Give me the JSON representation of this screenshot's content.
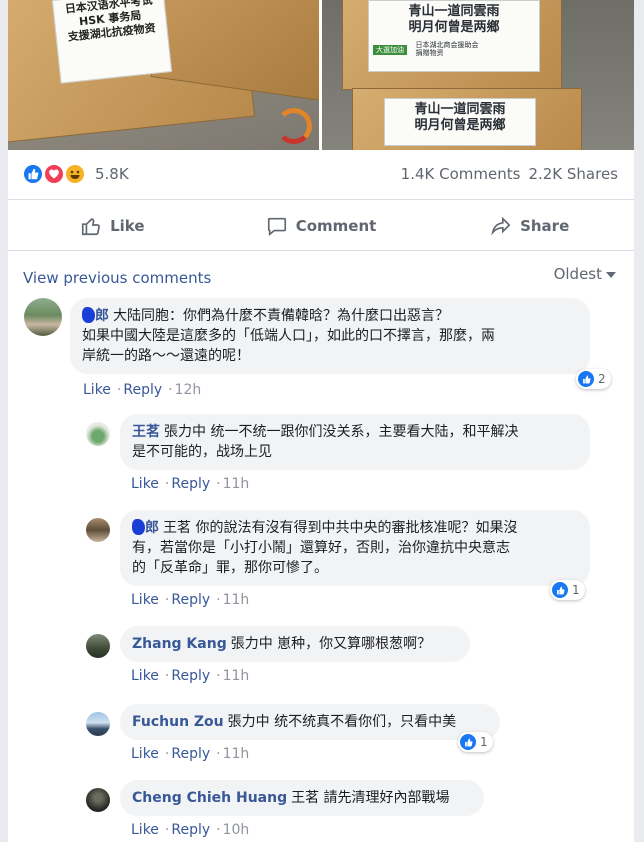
{
  "photos": {
    "left_label": [
      "日本汉语水平考试",
      "HSK 事务局",
      "支援湖北抗疫物资"
    ],
    "right_label_top": [
      "青山一道同雲雨",
      "明月何曾是两鄉"
    ],
    "right_tag": "大選加油",
    "right_small": [
      "日本湖北商会援助会",
      "捐赠物资"
    ],
    "right_label_bottom": [
      "青山一道同雲雨",
      "明月何曾是两鄉"
    ]
  },
  "stats": {
    "reactions_count": "5.8K",
    "comments": "1.4K Comments",
    "shares": "2.2K Shares"
  },
  "actions": {
    "like": "Like",
    "comment": "Comment",
    "share": "Share"
  },
  "comments_header": {
    "view_previous": "View previous comments",
    "sort": "Oldest"
  },
  "comments": [
    {
      "author": "郎",
      "text": "大陆同胞：你們為什麼不責備韓晗？為什麼口出惡言？",
      "text2": "如果中國大陸是這麼多的「低端人口」，如此的口不擇言，那麼，兩",
      "text3": "岸統一的路～～還遠的呢！",
      "like": "Like",
      "reply": "Reply",
      "time": "12h",
      "reactions": "2"
    },
    {
      "author": "王茗",
      "text": "張力中 统一不统一跟你们没关系，主要看大陆，和平解决",
      "text2": "是不可能的，战场上见",
      "like": "Like",
      "reply": "Reply",
      "time": "11h"
    },
    {
      "author": "郎",
      "text": "王茗 你的說法有沒有得到中共中央的審批核准呢？如果沒",
      "text2": "有，若當你是「小打小鬧」還算好，否則，治你違抗中央意志",
      "text3": "的「反革命」罪，那你可慘了。",
      "like": "Like",
      "reply": "Reply",
      "time": "11h",
      "reactions": "1"
    },
    {
      "author": "Zhang Kang",
      "text": "張力中 崽种，你又算哪根葱啊？",
      "like": "Like",
      "reply": "Reply",
      "time": "11h"
    },
    {
      "author": "Fuchun Zou",
      "text": "張力中 统不统真不看你们，只看中美",
      "like": "Like",
      "reply": "Reply",
      "time": "11h",
      "reactions": "1"
    },
    {
      "author": "Cheng Chieh Huang",
      "text": "王茗 請先清理好內部戰場",
      "like": "Like",
      "reply": "Reply",
      "time": "10h"
    }
  ]
}
